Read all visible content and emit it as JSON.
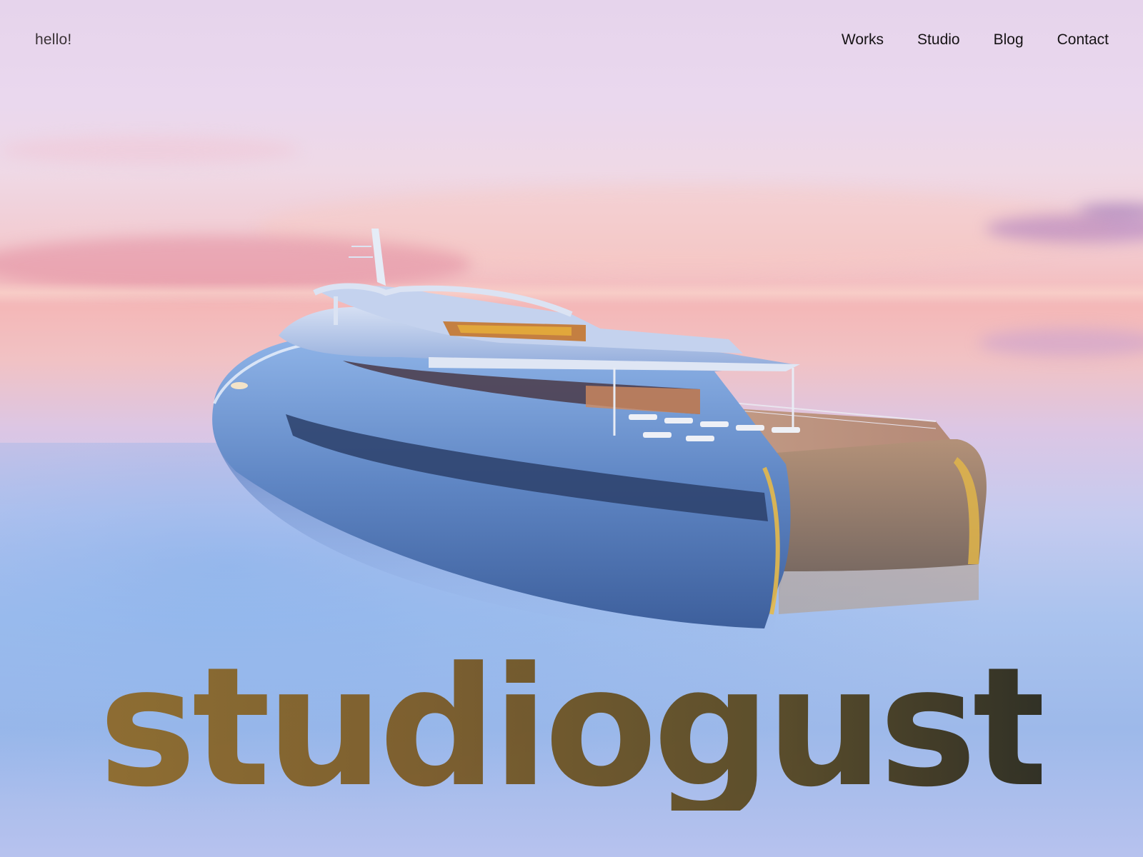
{
  "header": {
    "greeting": "hello!",
    "nav": [
      {
        "label": "Works"
      },
      {
        "label": "Studio"
      },
      {
        "label": "Blog"
      },
      {
        "label": "Contact"
      }
    ]
  },
  "hero": {
    "image_subject": "yacht-at-sunset",
    "brand": "studiogusto"
  },
  "colors": {
    "nav_text": "#161315",
    "logo_start": "#8e6a2a",
    "logo_end": "#2c2a1c"
  }
}
